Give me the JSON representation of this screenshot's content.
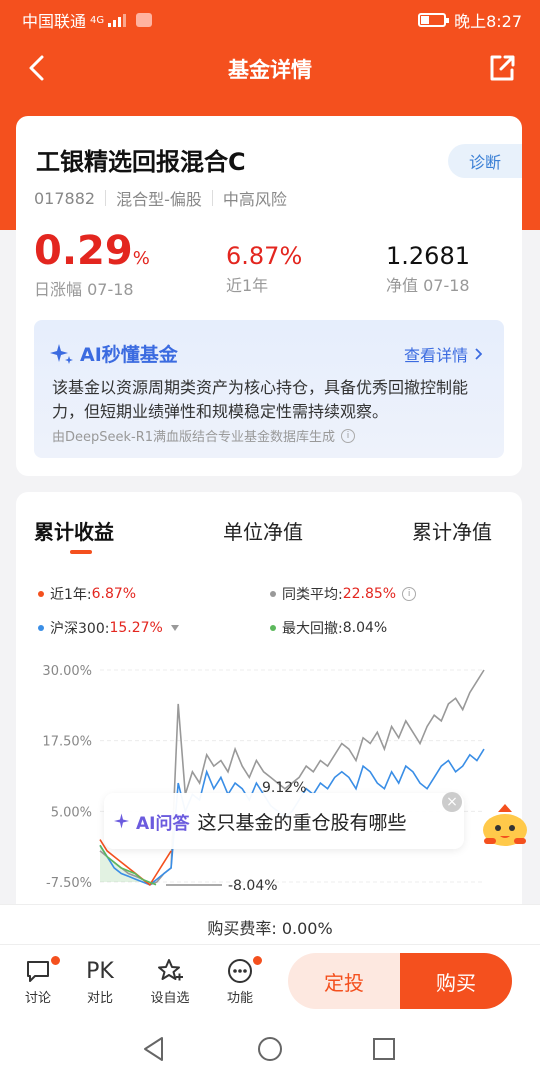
{
  "status_bar": {
    "carrier": "中国联通",
    "network": "4G",
    "time": "晚上8:27"
  },
  "nav": {
    "title": "基金详情"
  },
  "fund": {
    "name": "工银精选回报混合C",
    "diagnose_label": "诊断",
    "code": "017882",
    "type": "混合型-偏股",
    "risk": "中高风险",
    "daily_change_value": "0.29",
    "daily_change_unit": "%",
    "daily_change_label": "日涨幅 07-18",
    "one_year_value": "6.87%",
    "one_year_label": "近1年",
    "nav_value": "1.2681",
    "nav_label": "净值 07-18"
  },
  "ai_card": {
    "title": "AI秒懂基金",
    "more_label": "查看详情",
    "description": "该基金以资源周期类资产为核心持仓，具备优秀回撤控制能力，但短期业绩弹性和规模稳定性需持续观察。",
    "source": "由DeepSeek-R1满血版结合专业基金数据库生成"
  },
  "chart_section": {
    "tabs": [
      "累计收益",
      "单位净值",
      "累计净值"
    ],
    "active_tab": 0,
    "legend": [
      {
        "label": "近1年:",
        "value": "6.87%",
        "color": "#f4501e"
      },
      {
        "label": "同类平均:",
        "value": "22.85%",
        "color": "#999999"
      },
      {
        "label": "沪深300:",
        "value": "15.27%",
        "color": "#3a8ee6"
      },
      {
        "label": "最大回撤:",
        "value": "8.04%",
        "color": "#5cb85c"
      }
    ]
  },
  "chart_data": {
    "type": "line",
    "y_ticks": [
      "30.00%",
      "17.50%",
      "5.00%",
      "-7.50%"
    ],
    "ylim": [
      -7.5,
      30
    ],
    "grid": true,
    "annotations": [
      "9.12%",
      "-8.04%"
    ],
    "series": [
      {
        "name": "同类平均",
        "color": "#999999",
        "values": [
          -2,
          -3,
          -4,
          -5,
          -6,
          -6.5,
          -7,
          -8,
          -7.5,
          -6,
          -5,
          24,
          8,
          12,
          10,
          15,
          13,
          14,
          12,
          16,
          13,
          11,
          14,
          12,
          11,
          10,
          9,
          10,
          11,
          13,
          12,
          14,
          13,
          15,
          17,
          16,
          14,
          18,
          17,
          19,
          16,
          20,
          18,
          21,
          19,
          17,
          20,
          22,
          21,
          24,
          25,
          23,
          26,
          28,
          30
        ]
      },
      {
        "name": "沪深300",
        "color": "#3a8ee6",
        "values": [
          -1,
          -3,
          -5,
          -6,
          -6.5,
          -7,
          -7.5,
          -8,
          -7,
          -6,
          -5,
          10,
          5,
          8,
          7,
          12,
          9,
          11,
          8,
          10,
          9,
          7,
          10,
          8,
          6,
          5,
          4,
          5,
          7,
          9,
          8,
          10,
          9,
          11,
          12,
          11,
          9,
          13,
          12,
          10,
          9,
          12,
          10,
          13,
          12,
          10,
          9,
          11,
          13,
          14,
          12,
          13,
          15,
          14,
          16
        ]
      },
      {
        "name": "近1年",
        "color": "#f4501e",
        "values": [
          0,
          -2,
          -3,
          -4,
          -5,
          -6,
          -7,
          -8,
          -6,
          -4,
          -2
        ]
      },
      {
        "name": "最大回撤",
        "color": "#5cb85c",
        "values": [
          -1,
          -3,
          -4,
          -5,
          -5.5,
          -6,
          -7,
          -7.5,
          -8
        ]
      }
    ]
  },
  "ai_bubble": {
    "tag": "AI问答",
    "question": "这只基金的重仓股有哪些"
  },
  "fee": {
    "label": "购买费率: 0.00%"
  },
  "bottom_bar": {
    "discuss_label": "讨论",
    "pk_icon_text": "PK",
    "compare_label": "对比",
    "watch_label": "设自选",
    "function_label": "功能",
    "plan_label": "定投",
    "buy_label": "购买"
  }
}
